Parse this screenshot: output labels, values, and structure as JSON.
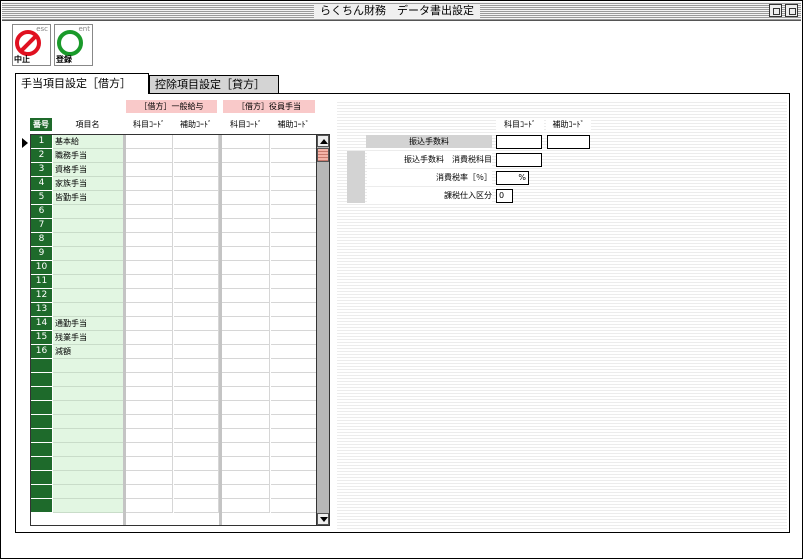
{
  "window": {
    "title": "らくちん財務　データ書出設定"
  },
  "toolbar": {
    "cancel": {
      "label": "中止",
      "key": "esc"
    },
    "register": {
      "label": "登録",
      "key": "ent"
    }
  },
  "tabs": [
    {
      "label": "手当項目設定［借方］",
      "active": true
    },
    {
      "label": "控除項目設定［貸方］",
      "active": false
    }
  ],
  "grid": {
    "group_headers": [
      "［借方］一般給与",
      "［借方］役員手当"
    ],
    "columns": [
      "番号",
      "項目名",
      "科目ｺｰﾄﾞ",
      "補助ｺｰﾄﾞ",
      "科目ｺｰﾄﾞ",
      "補助ｺｰﾄﾞ"
    ],
    "rows": [
      {
        "num": "1",
        "name": "基本給"
      },
      {
        "num": "2",
        "name": "職務手当"
      },
      {
        "num": "3",
        "name": "資格手当"
      },
      {
        "num": "4",
        "name": "家族手当"
      },
      {
        "num": "5",
        "name": "皆勤手当"
      },
      {
        "num": "6",
        "name": ""
      },
      {
        "num": "7",
        "name": ""
      },
      {
        "num": "8",
        "name": ""
      },
      {
        "num": "9",
        "name": ""
      },
      {
        "num": "10",
        "name": ""
      },
      {
        "num": "11",
        "name": ""
      },
      {
        "num": "12",
        "name": ""
      },
      {
        "num": "13",
        "name": ""
      },
      {
        "num": "14",
        "name": "通勤手当"
      },
      {
        "num": "15",
        "name": "残業手当"
      },
      {
        "num": "16",
        "name": "減額"
      },
      {
        "num": "",
        "name": ""
      },
      {
        "num": "",
        "name": ""
      },
      {
        "num": "",
        "name": ""
      },
      {
        "num": "",
        "name": ""
      },
      {
        "num": "",
        "name": ""
      },
      {
        "num": "",
        "name": ""
      },
      {
        "num": "",
        "name": ""
      },
      {
        "num": "",
        "name": ""
      },
      {
        "num": "",
        "name": ""
      },
      {
        "num": "",
        "name": ""
      },
      {
        "num": "",
        "name": ""
      }
    ]
  },
  "right_panel": {
    "col_headers": [
      "科目ｺｰﾄﾞ",
      "補助ｺｰﾄﾞ"
    ],
    "transfer_fee_label": "振込手数料",
    "transfer_tax_account_label": "振込手数料　消費税科目",
    "tax_rate_label": "消費税率［％］",
    "tax_rate_unit": "%",
    "tax_category_label": "課税仕入区分",
    "tax_category_value": "0"
  },
  "colors": {
    "number_column": "#1e6a2b",
    "name_column": "#e2f6e2",
    "group_header": "#f9c9c9"
  }
}
